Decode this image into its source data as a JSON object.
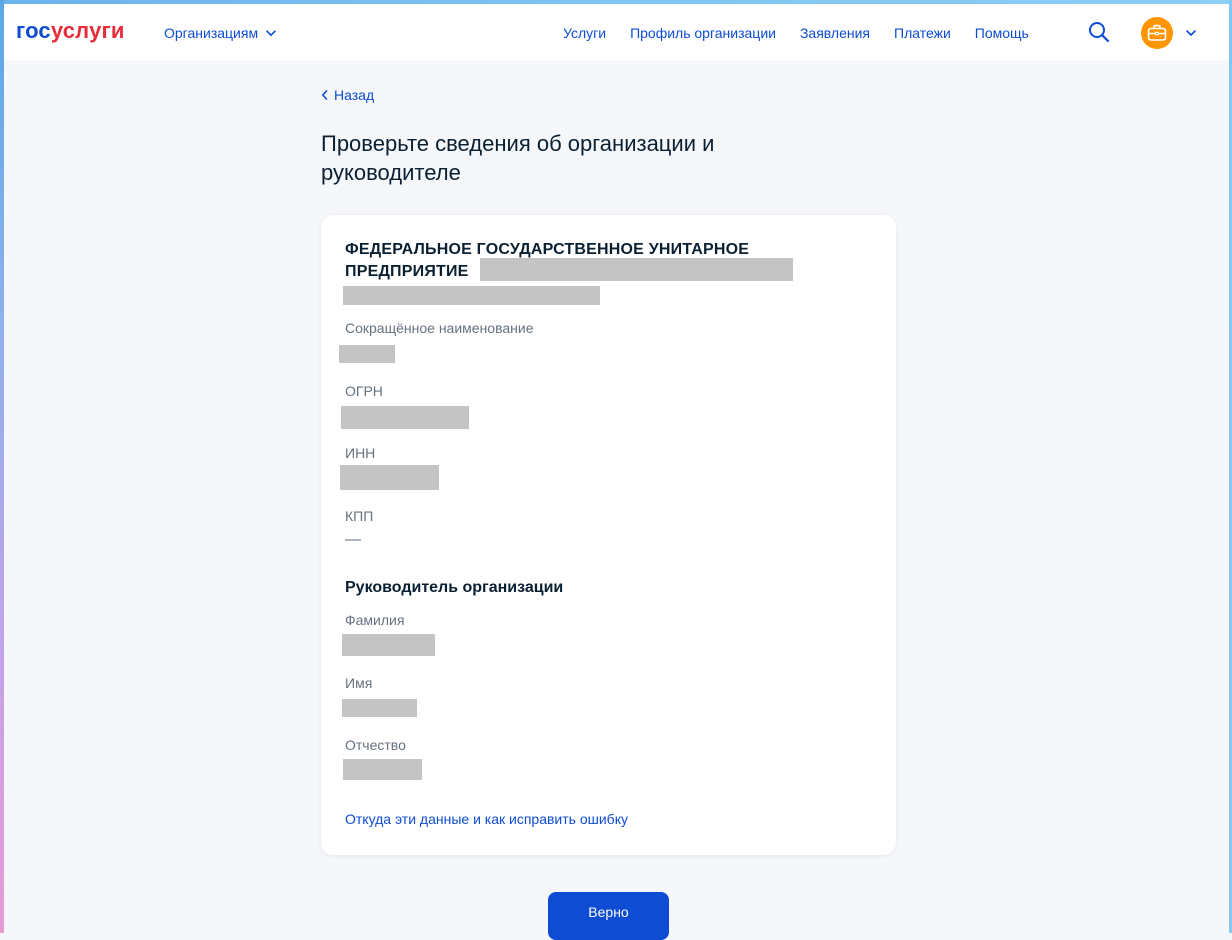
{
  "header": {
    "logo_part1": "гос",
    "logo_part2": "услуги",
    "org_menu_label": "Организациям",
    "nav": [
      "Услуги",
      "Профиль организации",
      "Заявления",
      "Платежи",
      "Помощь"
    ]
  },
  "back_label": "Назад",
  "page_title": "Проверьте сведения об организации и руководителе",
  "organization": {
    "full_name_visible": "ФЕДЕРАЛЬНОЕ ГОСУДАРСТВЕННОЕ УНИТАРНОЕ ПРЕДПРИЯТИЕ",
    "fields": [
      {
        "label": "Сокращённое наименование",
        "value": ""
      },
      {
        "label": "ОГРН",
        "value": ""
      },
      {
        "label": "ИНН",
        "value": ""
      },
      {
        "label": "КПП",
        "value": "—"
      }
    ]
  },
  "director": {
    "section_title": "Руководитель организации",
    "fields": [
      {
        "label": "Фамилия",
        "value": ""
      },
      {
        "label": "Имя",
        "value": ""
      },
      {
        "label": "Отчество",
        "value": ""
      }
    ]
  },
  "help_link": "Откуда эти данные и как исправить ошибку",
  "confirm_button": "Верно",
  "colors": {
    "accent": "#0d4cd3",
    "logo_red": "#e82c3a",
    "avatar": "#ff9500",
    "redaction": "#c4c4c4"
  },
  "icons": {
    "org_menu": "chevron-down-icon",
    "back": "chevron-left-icon",
    "search": "search-icon",
    "avatar": "briefcase-icon",
    "avatar_menu": "chevron-down-icon"
  }
}
